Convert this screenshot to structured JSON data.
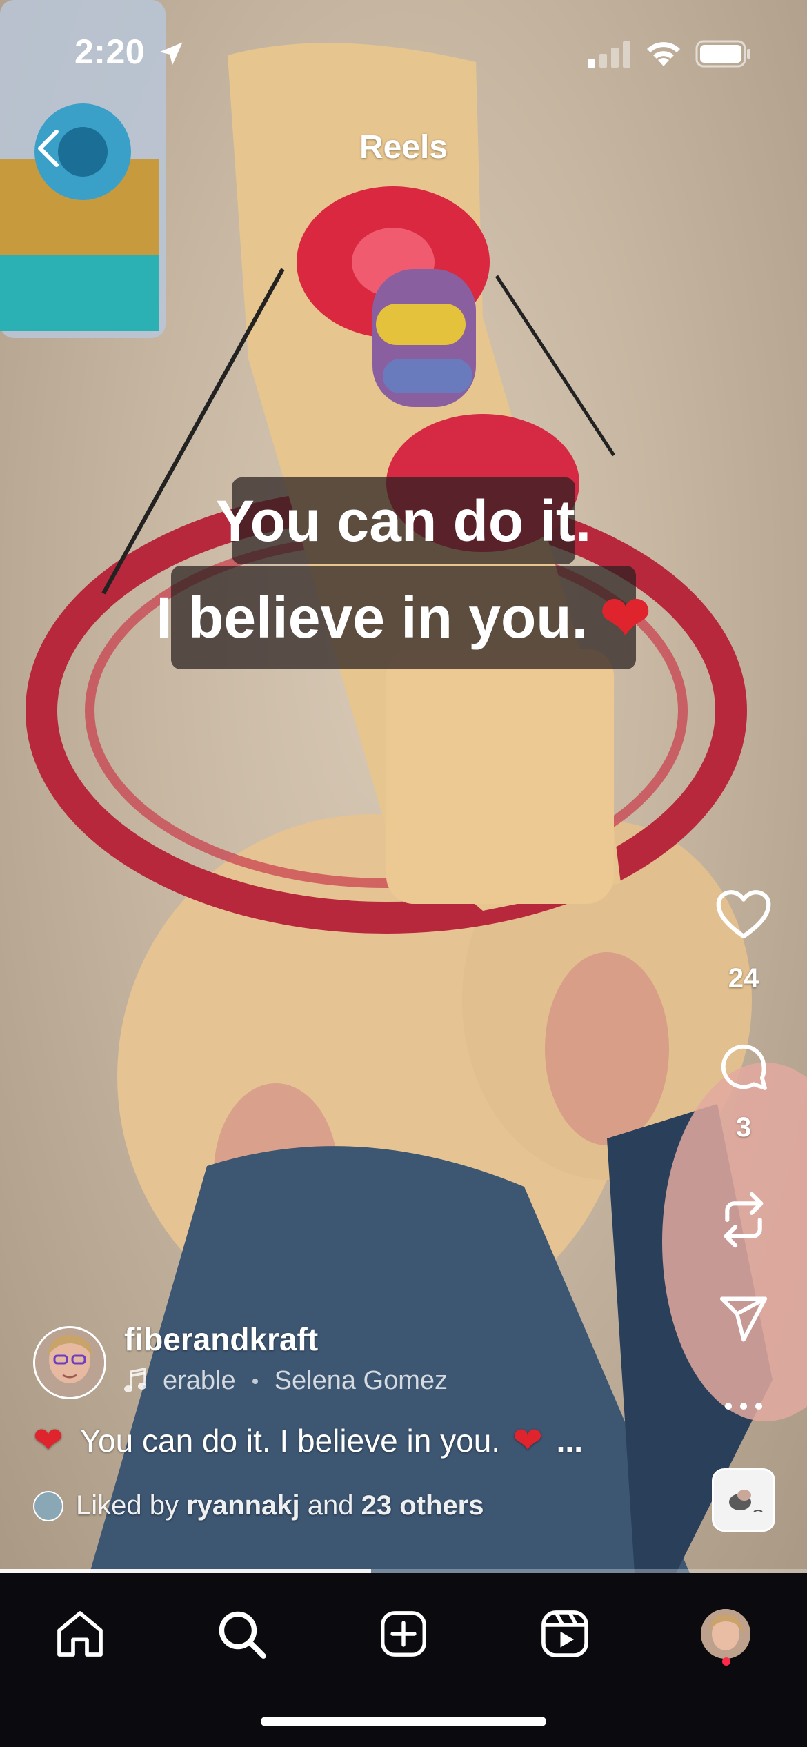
{
  "status_bar": {
    "time": "2:20"
  },
  "header": {
    "title": "Reels"
  },
  "overlay": {
    "line1": "You can do it.",
    "line2": "I believe in you.",
    "heart": "❤"
  },
  "actions": {
    "like_count": "24",
    "comment_count": "3"
  },
  "post": {
    "username": "fiberandkraft",
    "music_track": "erable",
    "music_artist": "Selena Gomez",
    "description": "You can do it. I believe in you.",
    "more": "...",
    "liked_prefix": "Liked by",
    "liked_user": "ryannakj",
    "liked_and": "and",
    "liked_others": "23 others"
  },
  "colors": {
    "accent_heart": "#e0242e",
    "tab_bar": "#0b0b0f",
    "notification": "#ff2a4a"
  },
  "icons": [
    "location-arrow-icon",
    "signal-icon",
    "wifi-icon",
    "battery-icon",
    "back-icon",
    "heart-icon",
    "comment-icon",
    "repost-icon",
    "send-icon",
    "more-icon",
    "music-note-icon",
    "home-icon",
    "search-icon",
    "create-icon",
    "reels-icon"
  ],
  "playback": {
    "progress_fraction": 0.46
  }
}
